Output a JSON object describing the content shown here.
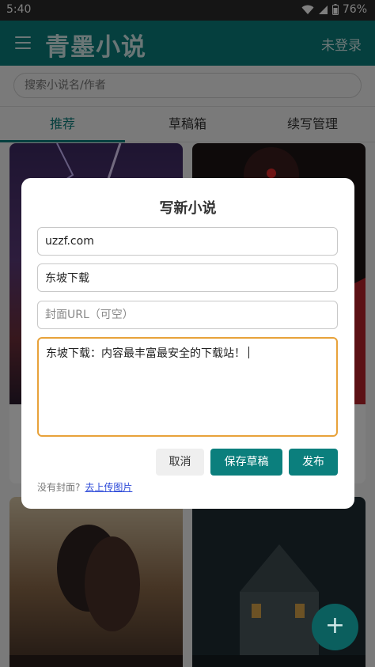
{
  "status_bar": {
    "time": "5:40",
    "battery": "76%"
  },
  "app_bar": {
    "title": "青墨小说",
    "login_label": "未登录"
  },
  "search": {
    "placeholder": "搜索小说名/作者"
  },
  "tabs": [
    {
      "label": "推荐"
    },
    {
      "label": "草稿箱"
    },
    {
      "label": "续写管理"
    }
  ],
  "dialog": {
    "title": "写新小说",
    "title_value": "uzzf.com",
    "author_value": "东坡下载",
    "cover_placeholder": "封面URL（可空）",
    "content_value": "东坡下载：内容最丰富最安全的下载站！",
    "cancel_label": "取消",
    "save_label": "保存草稿",
    "publish_label": "发布",
    "hint_text": "没有封面?",
    "upload_link": "去上传图片"
  },
  "fab": {
    "label": "+"
  },
  "colors": {
    "accent": "#0b7f7d",
    "focus_border": "#e8a23a",
    "link": "#2b48d8"
  }
}
